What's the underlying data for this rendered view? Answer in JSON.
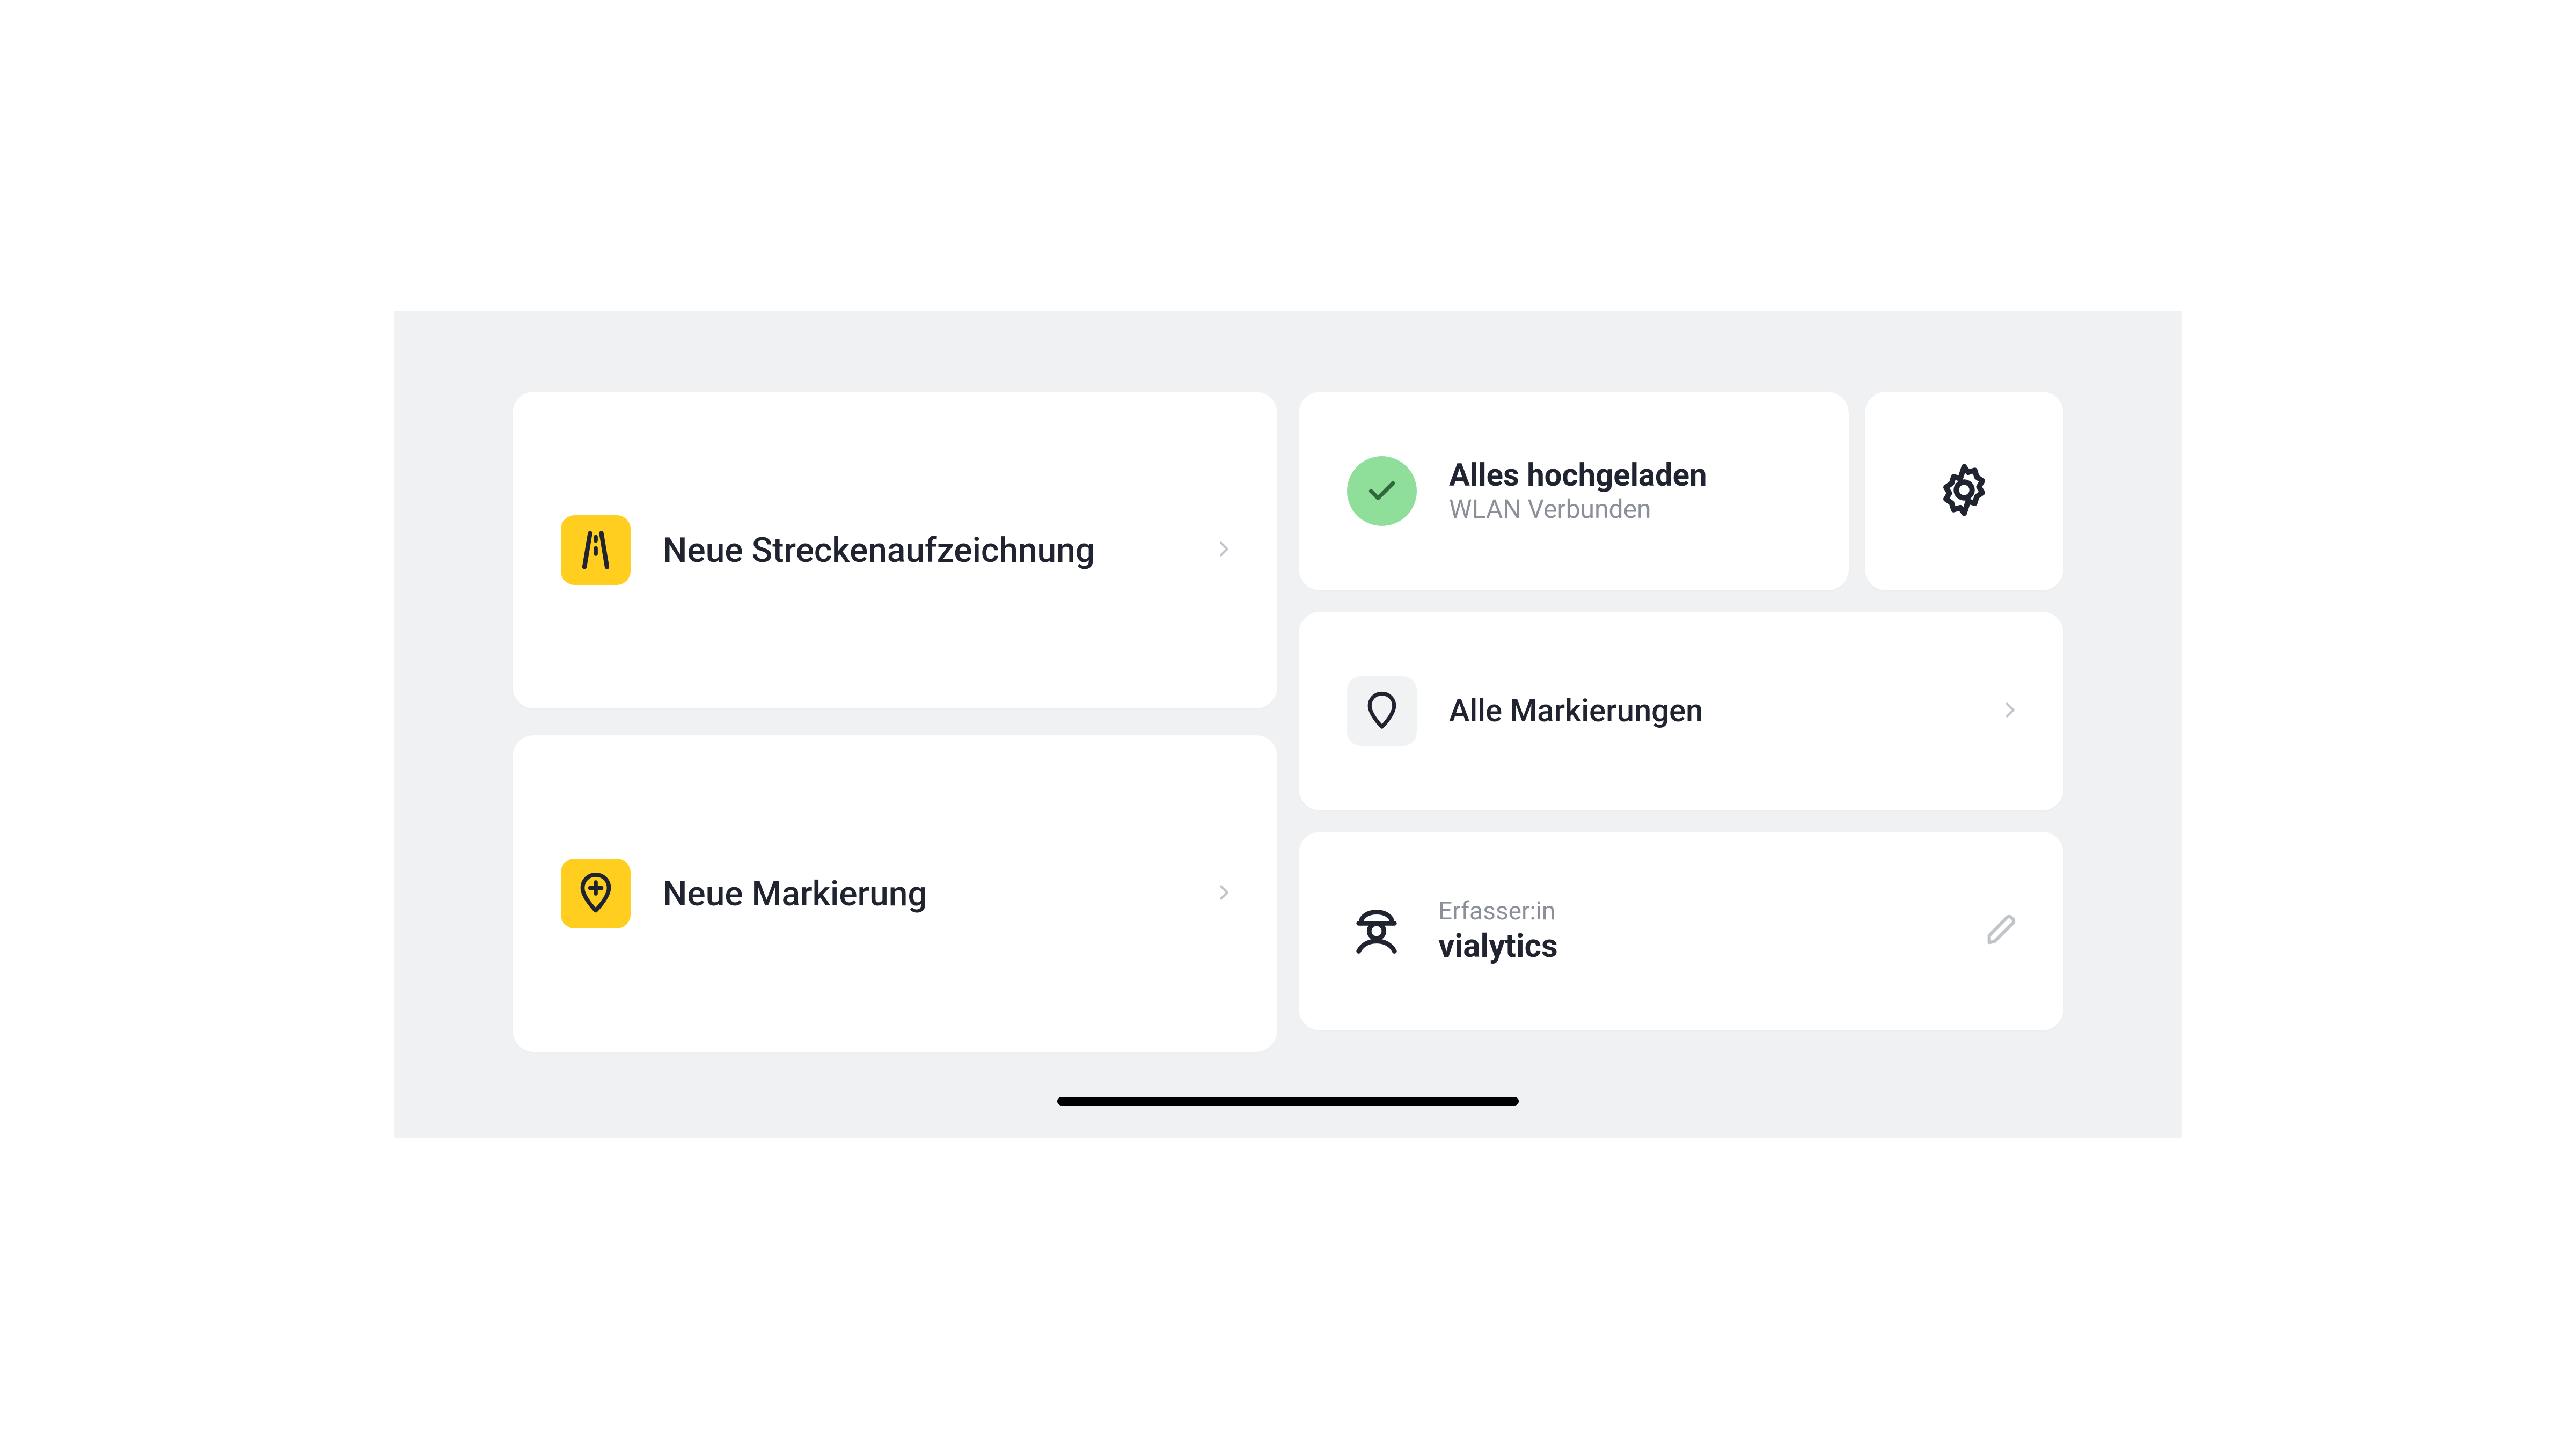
{
  "actions": {
    "record_route": "Neue Streckenaufzeichnung",
    "new_marker": "Neue Markierung"
  },
  "status": {
    "title": "Alles hochgeladen",
    "subtitle": "WLAN Verbunden"
  },
  "markers": {
    "all": "Alle Markierungen"
  },
  "user": {
    "caption": "Erfasser:in",
    "name": "vialytics"
  },
  "icons": {
    "road": "road-icon",
    "marker_add": "marker-add-icon",
    "check": "check-icon",
    "gear": "gear-icon",
    "marker": "marker-icon",
    "worker": "worker-icon",
    "pencil": "pencil-icon",
    "chevron": "chevron-right-icon"
  },
  "colors": {
    "accent_yellow": "#ffce1f",
    "success_green": "#8fdf9a",
    "text": "#1f2430",
    "muted": "#8a8f98",
    "card_bg": "#ffffff",
    "app_bg": "#f0f1f3"
  }
}
